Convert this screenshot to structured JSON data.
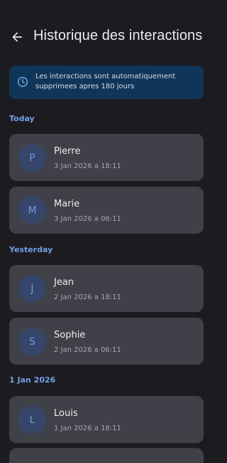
{
  "header": {
    "title": "Historique des interactions",
    "back_icon": "arrow-left-icon"
  },
  "banner": {
    "icon": "clock-icon",
    "text": "Les interactions sont automatiquement supprimees apres 180 jours",
    "color": "#0f3659"
  },
  "sections": [
    {
      "label": "Today",
      "items": [
        {
          "initial": "P",
          "name": "Pierre",
          "date": "3 Jan 2026 a 18:11"
        },
        {
          "initial": "M",
          "name": "Marie",
          "date": "3 Jan 2026 a 06:11"
        }
      ]
    },
    {
      "label": "Yesterday",
      "items": [
        {
          "initial": "J",
          "name": "Jean",
          "date": "2 Jan 2026 a 18:11"
        },
        {
          "initial": "S",
          "name": "Sophie",
          "date": "2 Jan 2026 a 06:11"
        }
      ]
    },
    {
      "label": "1 Jan 2026",
      "items": [
        {
          "initial": "L",
          "name": "Louis",
          "date": "1 Jan 2026 a 18:11"
        }
      ]
    }
  ],
  "colors": {
    "accent": "#6fa0e6",
    "card": "#404148",
    "background": "#1c1c20"
  }
}
